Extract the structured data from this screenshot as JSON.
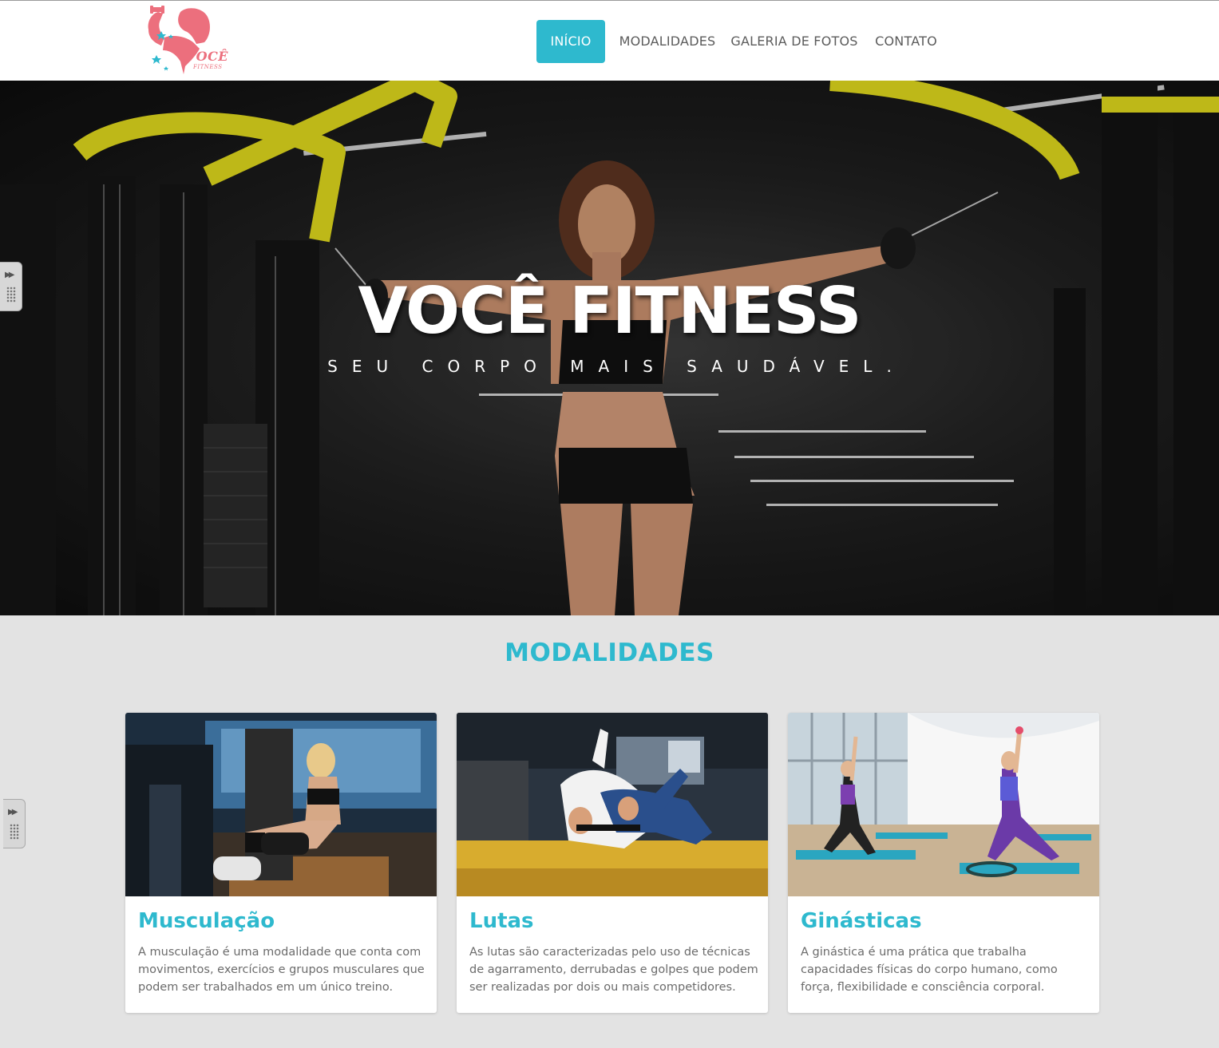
{
  "brand": {
    "logo_text": "VOCÊ",
    "logo_sub": "FITNESS",
    "colors": {
      "accent": "#2eb9ce",
      "logo_pink": "#ec6f7d"
    }
  },
  "nav": {
    "items": [
      {
        "label": "INÍCIO",
        "active": true
      },
      {
        "label": "MODALIDADES",
        "active": false
      },
      {
        "label": "GALERIA DE FOTOS",
        "active": false
      },
      {
        "label": "CONTATO",
        "active": false
      }
    ]
  },
  "hero": {
    "title": "VOCÊ FITNESS",
    "subtitle": "SEU CORPO MAIS SAUDÁVEL."
  },
  "modalidades": {
    "title": "MODALIDADES",
    "cards": [
      {
        "title": "Musculação",
        "text": "A musculação é uma modalidade que conta com movimentos, exercícios e grupos musculares que podem ser trabalhados em um único treino."
      },
      {
        "title": "Lutas",
        "text": "As lutas são caracterizadas pelo uso de técnicas de agarramento, derrubadas e golpes que podem ser realizadas por dois ou mais competidores."
      },
      {
        "title": "Ginásticas",
        "text": "A ginástica é uma prática que trabalha capacidades físicas do corpo humano, como força, flexibilidade e consciência corporal."
      }
    ]
  },
  "icons": {
    "side_handle": "expand-arrows-icon",
    "logo": "fitness-woman-logo-icon"
  }
}
